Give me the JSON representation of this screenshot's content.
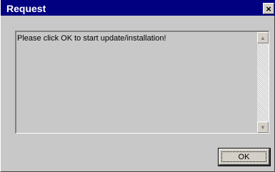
{
  "window": {
    "title": "Request",
    "close_icon": "close-icon",
    "close_glyph": "×"
  },
  "message": {
    "text": "Please click OK to start update/installation!"
  },
  "scrollbar": {
    "up_icon": "arrow-up-icon",
    "down_icon": "arrow-down-icon",
    "up_glyph": "▲",
    "down_glyph": "▼"
  },
  "buttons": {
    "ok_label": "OK"
  },
  "colors": {
    "titlebar": "#000080",
    "window_bg": "#c8c8c8"
  }
}
